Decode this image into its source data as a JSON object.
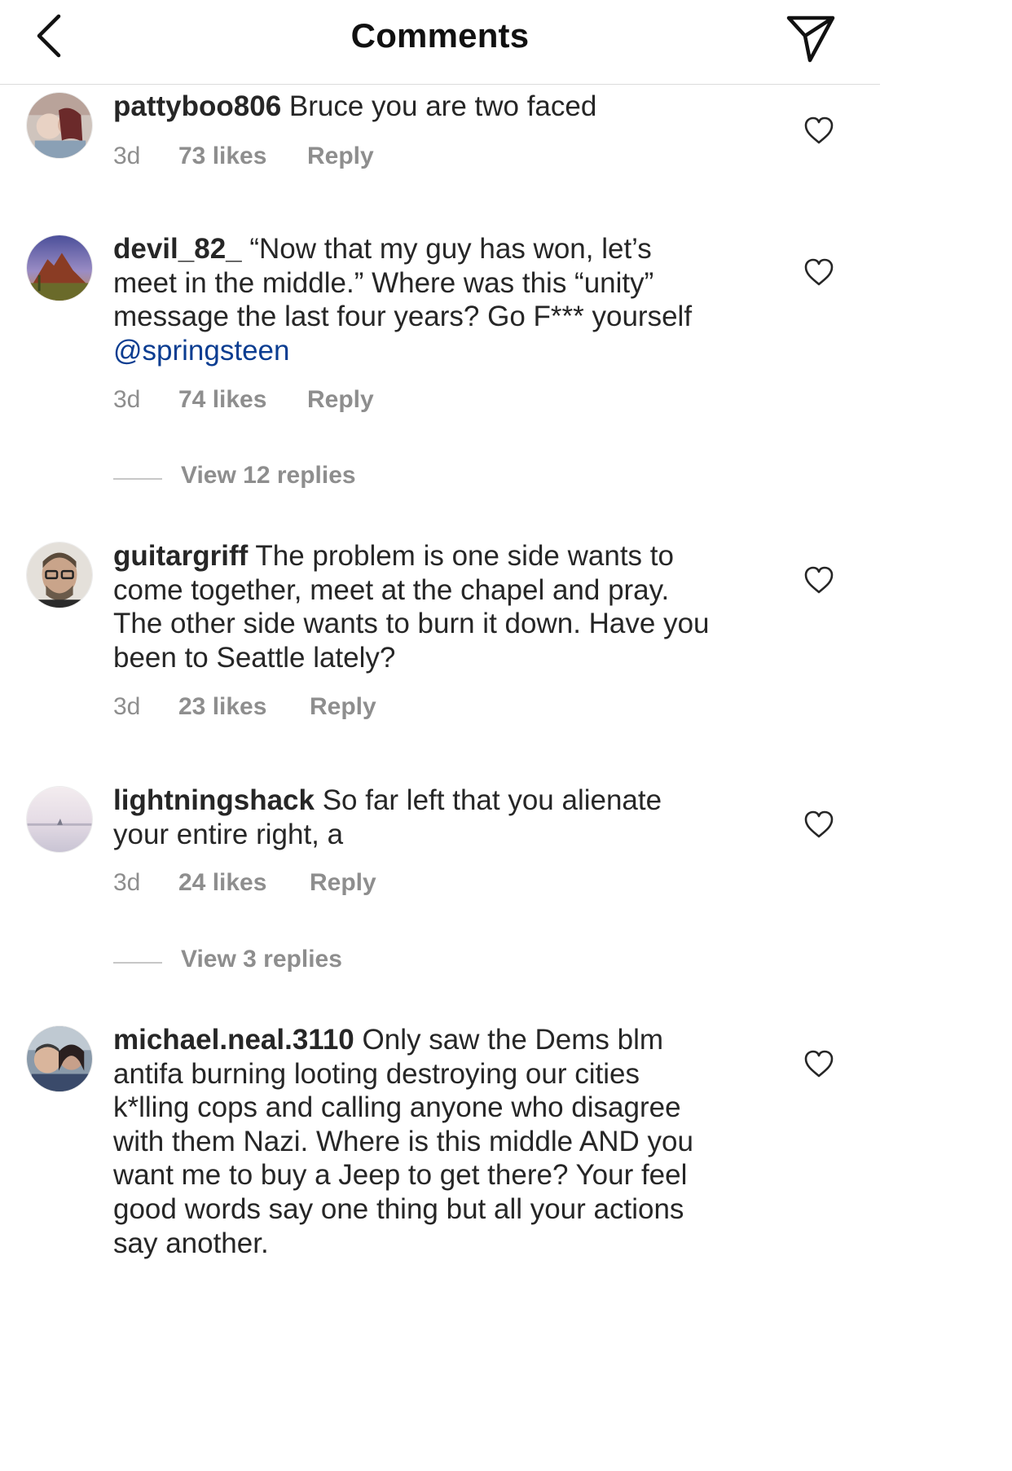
{
  "header": {
    "title": "Comments",
    "back_icon": "chevron-left-icon",
    "send_icon": "paper-plane-icon"
  },
  "colors": {
    "text": "#262626",
    "meta": "#8e8e8e",
    "mention": "#0b3d91",
    "divider": "#dbdbdb"
  },
  "comments": [
    {
      "username": "pattyboo806",
      "lines": [
        "Bruce you are two faced"
      ],
      "time": "3d",
      "likes": "73 likes",
      "reply": "Reply"
    },
    {
      "username": "devil_82_",
      "lines": [
        "“Now that my guy has won, let’s",
        "meet in the middle.” Where was this “unity”",
        "message the last four years?  Go F*** yourself"
      ],
      "mention": "@springsteen",
      "time": "3d",
      "likes": "74 likes",
      "reply": "Reply",
      "view_replies": "View 12 replies"
    },
    {
      "username": "guitargriff",
      "lines": [
        "The problem is one side wants to",
        "come together, meet at the chapel and pray.",
        "The other side wants to burn it down. Have you",
        "been to Seattle lately?"
      ],
      "time": "3d",
      "likes": "23 likes",
      "reply": "Reply"
    },
    {
      "username": "lightningshack",
      "lines": [
        "So far left that you alienate",
        "your entire right,  a"
      ],
      "time": "3d",
      "likes": "24 likes",
      "reply": "Reply",
      "view_replies": "View 3 replies"
    },
    {
      "username": "michael.neal.3110",
      "lines": [
        "Only saw the Dems blm",
        "antifa burning looting destroying our cities",
        "k*lling cops and calling anyone who disagree",
        "with them Nazi. Where is this middle AND you",
        "want me to buy a Jeep to get there? Your feel",
        "good words say one thing but all your actions",
        "say another."
      ]
    }
  ]
}
